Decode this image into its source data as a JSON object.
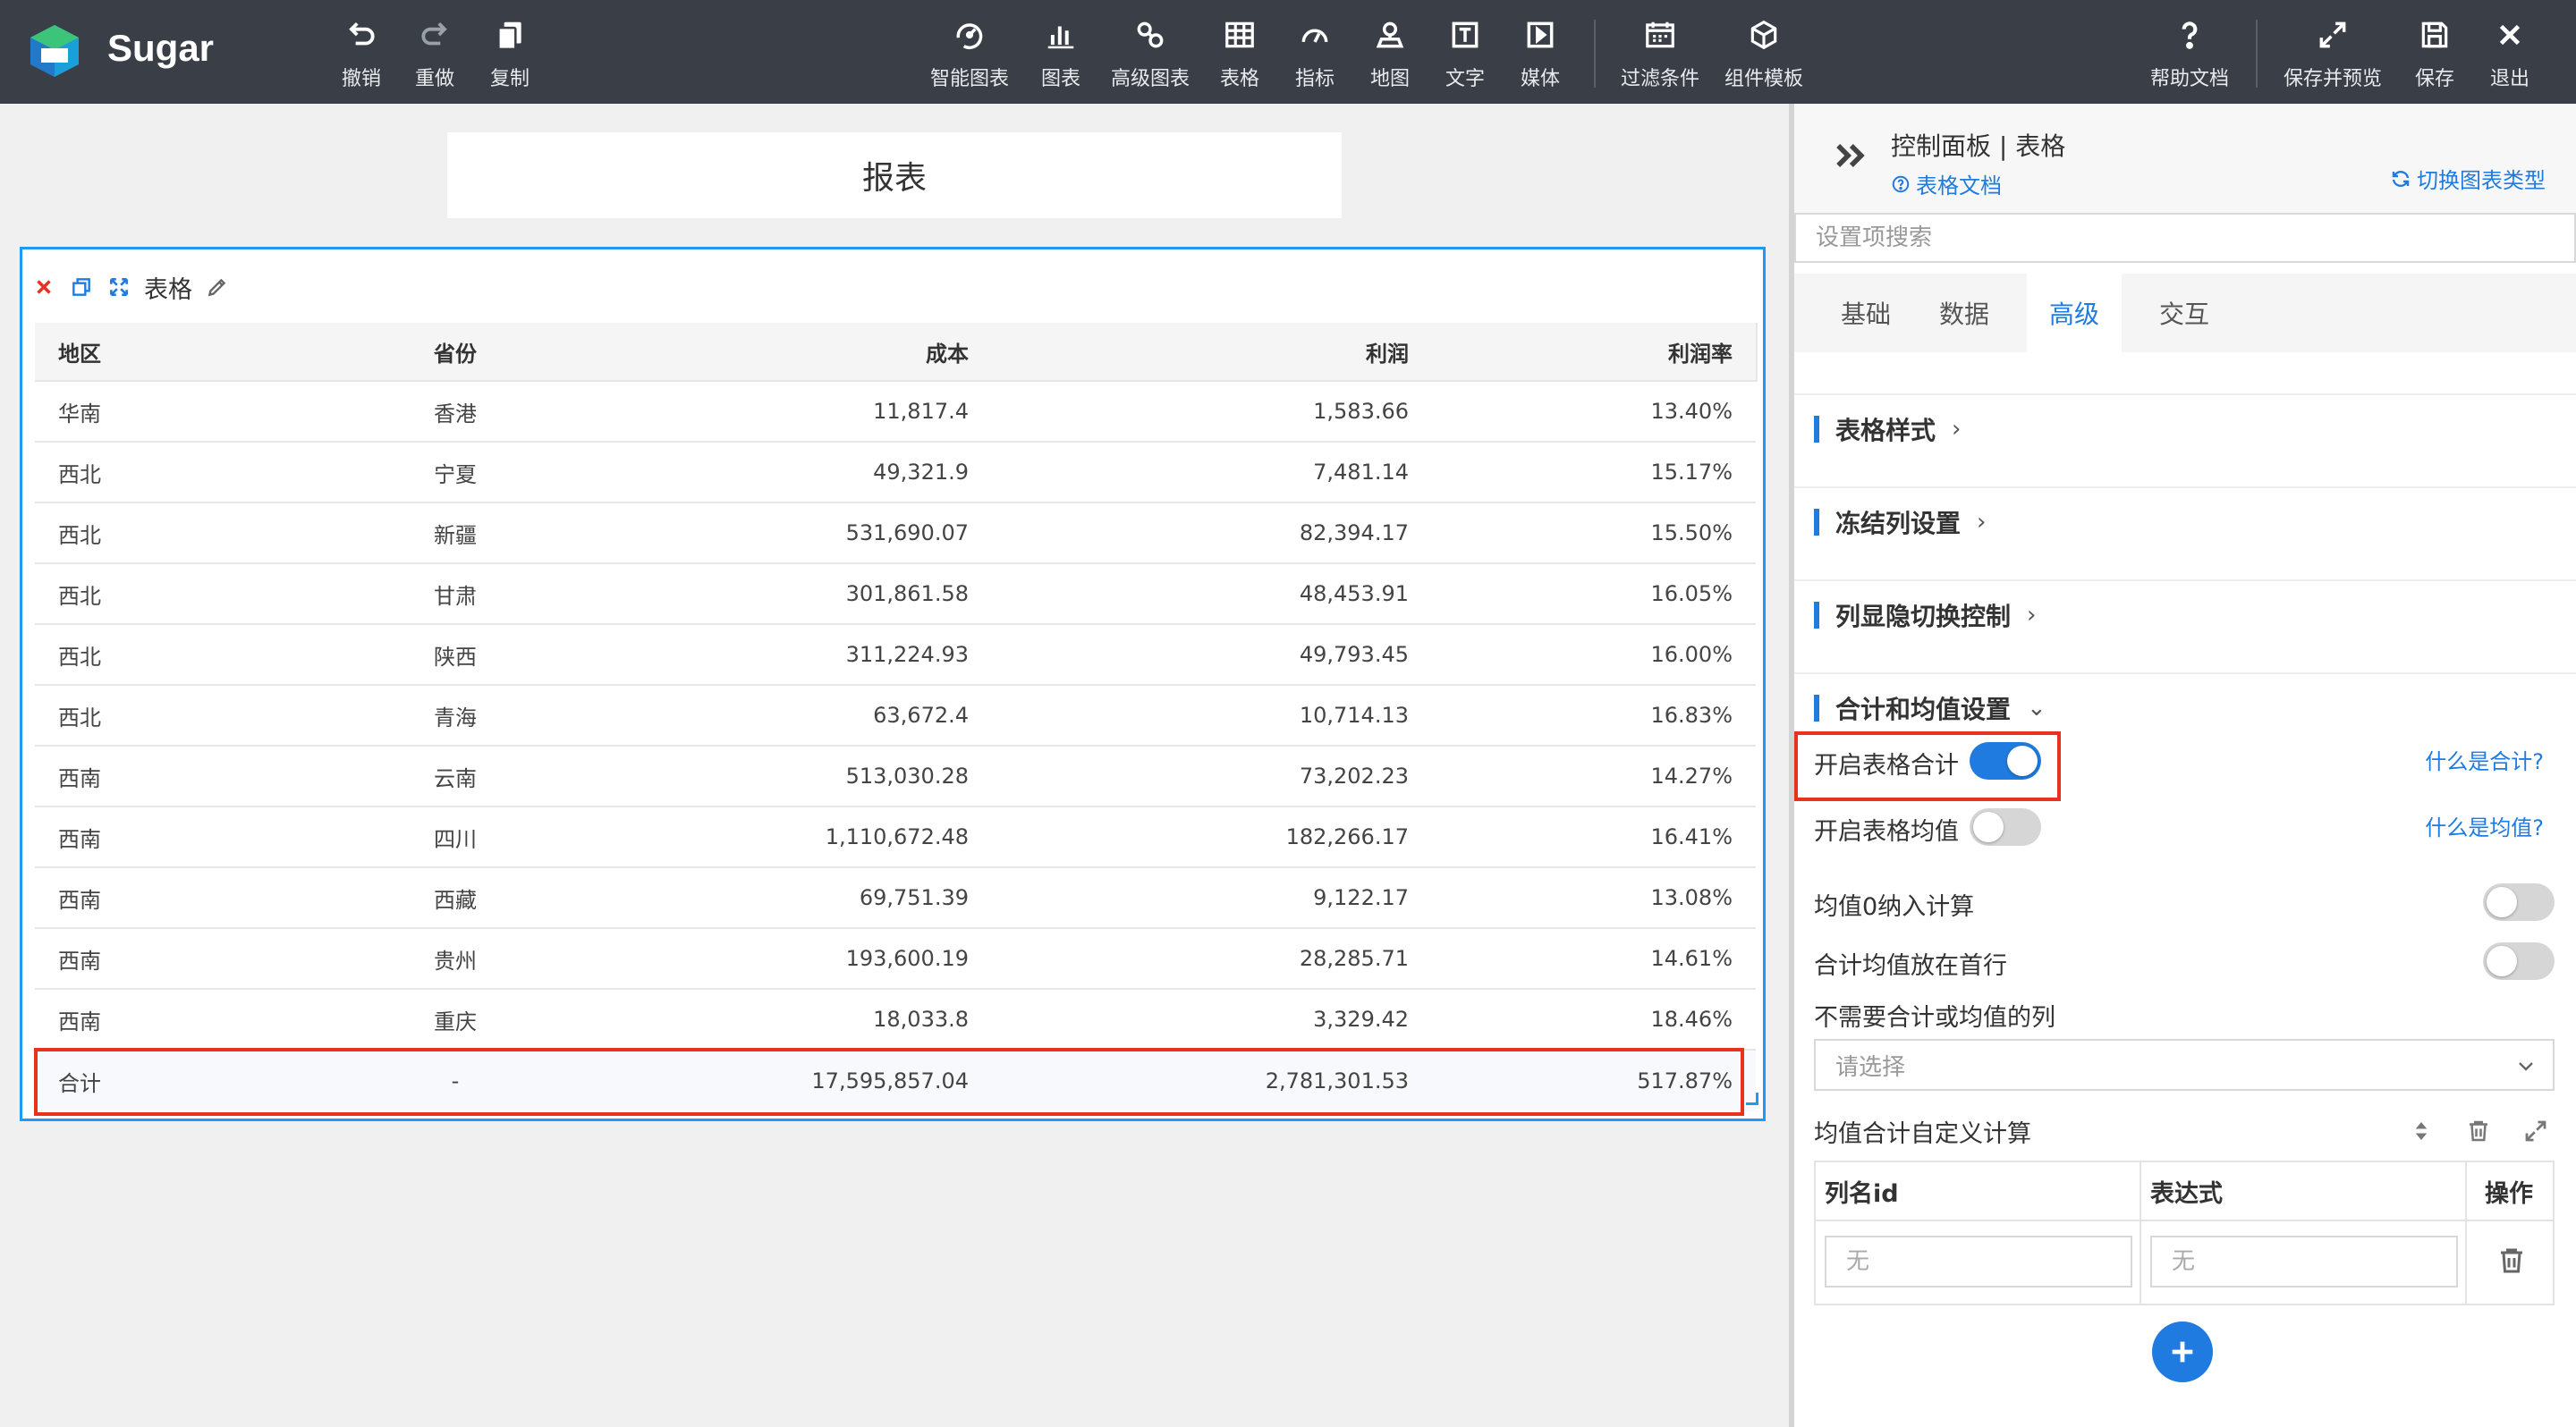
{
  "brand": "Sugar",
  "toolbar": {
    "undo": "撤销",
    "redo": "重做",
    "copy": "复制",
    "smart_chart": "智能图表",
    "chart": "图表",
    "advanced_chart": "高级图表",
    "table": "表格",
    "indicator": "指标",
    "map": "地图",
    "text": "文字",
    "media": "媒体",
    "filter": "过滤条件",
    "component_template": "组件模板",
    "help_doc": "帮助文档",
    "save_preview": "保存并预览",
    "save": "保存",
    "exit": "退出"
  },
  "report_title": "报表",
  "widget": {
    "title": "表格",
    "columns": [
      "地区",
      "省份",
      "成本",
      "利润",
      "利润率"
    ],
    "rows": [
      [
        "华南",
        "香港",
        "11,817.4",
        "1,583.66",
        "13.40%"
      ],
      [
        "西北",
        "宁夏",
        "49,321.9",
        "7,481.14",
        "15.17%"
      ],
      [
        "西北",
        "新疆",
        "531,690.07",
        "82,394.17",
        "15.50%"
      ],
      [
        "西北",
        "甘肃",
        "301,861.58",
        "48,453.91",
        "16.05%"
      ],
      [
        "西北",
        "陕西",
        "311,224.93",
        "49,793.45",
        "16.00%"
      ],
      [
        "西北",
        "青海",
        "63,672.4",
        "10,714.13",
        "16.83%"
      ],
      [
        "西南",
        "云南",
        "513,030.28",
        "73,202.23",
        "14.27%"
      ],
      [
        "西南",
        "四川",
        "1,110,672.48",
        "182,266.17",
        "16.41%"
      ],
      [
        "西南",
        "西藏",
        "69,751.39",
        "9,122.17",
        "13.08%"
      ],
      [
        "西南",
        "贵州",
        "193,600.19",
        "28,285.71",
        "14.61%"
      ],
      [
        "西南",
        "重庆",
        "18,033.8",
        "3,329.42",
        "18.46%"
      ]
    ],
    "total": [
      "合计",
      "-",
      "17,595,857.04",
      "2,781,301.53",
      "517.87%"
    ]
  },
  "panel": {
    "title": "控制面板 | 表格",
    "doc_link": "表格文档",
    "switch_type": "切换图表类型",
    "search_placeholder": "设置项搜索",
    "tabs": [
      "基础",
      "数据",
      "高级",
      "交互"
    ],
    "active_tab": "高级",
    "sections": {
      "table_style": "表格样式",
      "freeze_columns": "冻结列设置",
      "column_toggle": "列显隐切换控制",
      "sum_avg": "合计和均值设置"
    },
    "options": {
      "enable_total": {
        "label": "开启表格合计",
        "on": true,
        "help": "什么是合计?"
      },
      "enable_avg": {
        "label": "开启表格均值",
        "on": false,
        "help": "什么是均值?"
      },
      "avg_zero": {
        "label": "均值0纳入计算",
        "on": false
      },
      "total_first_row": {
        "label": "合计均值放在首行",
        "on": false
      }
    },
    "exclude_columns": {
      "label": "不需要合计或均值的列",
      "placeholder": "请选择"
    },
    "custom_calc": {
      "label": "均值合计自定义计算",
      "col_id": "列名id",
      "expression": "表达式",
      "action": "操作",
      "col_placeholder": "无",
      "expr_placeholder": "无"
    }
  },
  "colors": {
    "toolbar_bg": "#3a3f47",
    "accent": "#1f7be0",
    "highlight": "#e8321e",
    "widget_border": "#1e9bf0"
  }
}
